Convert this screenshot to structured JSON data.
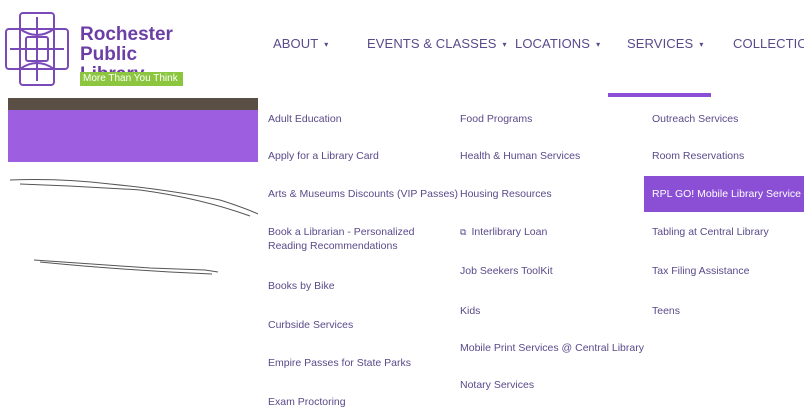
{
  "logo": {
    "name_line1": "Rochester",
    "name_line2": "Public Library",
    "tagline": "More Than You Think"
  },
  "nav": {
    "items": [
      {
        "label": "ABOUT",
        "has_dropdown": true
      },
      {
        "label": "EVENTS & CLASSES",
        "has_dropdown": true
      },
      {
        "label": "LOCATIONS",
        "has_dropdown": true
      },
      {
        "label": "SERVICES",
        "has_dropdown": true,
        "active": true
      },
      {
        "label": "COLLECTIONS",
        "has_dropdown": false
      }
    ],
    "chevron": "▾"
  },
  "services_menu": {
    "col1": [
      "Adult Education",
      "Apply for a Library Card",
      "Arts & Museums Discounts (VIP Passes)",
      "Book a Librarian - Personalized Reading Recommendations",
      "Books by Bike",
      "Curbside Services",
      "Empire Passes for State Parks",
      "Exam Proctoring"
    ],
    "col2": [
      "Food Programs",
      "Health & Human Services",
      "Housing Resources",
      "Interlibrary Loan",
      "Job Seekers ToolKit",
      "Kids",
      "Mobile Print Services @ Central Library",
      "Notary Services"
    ],
    "col3": [
      "Outreach Services",
      "Room Reservations",
      "RPL GO! Mobile Library Service",
      "Tabling at Central Library",
      "Tax Filing Assistance",
      "Teens"
    ],
    "active_item": "RPL GO! Mobile Library Service",
    "external_link_icon": "⧉"
  },
  "colors": {
    "brand_purple": "#6b3fa6",
    "accent_purple": "#8b4fd6",
    "hero_purple": "#9d5fe0",
    "tagline_green": "#8cc63f"
  }
}
